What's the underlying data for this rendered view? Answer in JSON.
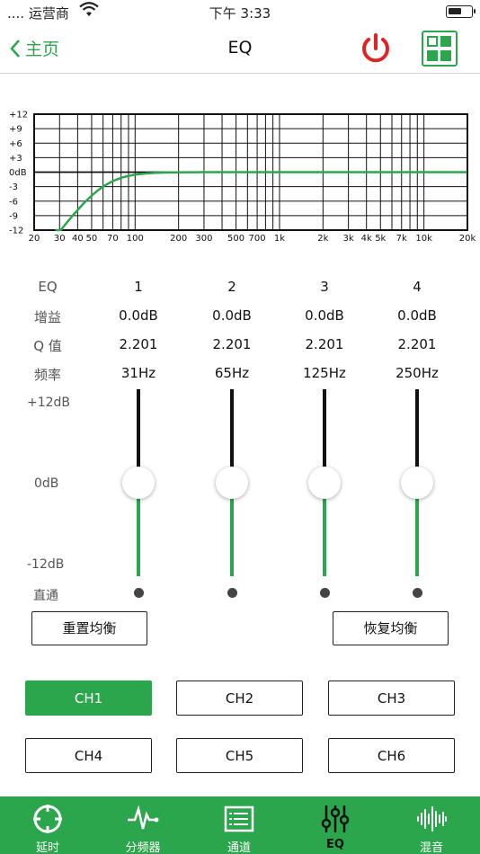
{
  "status_bar": {
    "carrier": "....  运营商",
    "time": "下午 3:33"
  },
  "nav": {
    "back_label": "主页",
    "title": "EQ"
  },
  "graph": {
    "y_ticks": [
      "+12",
      "+9",
      "+6",
      "+3",
      "0dB",
      "-3",
      "-6",
      "-9",
      "-12"
    ],
    "x_ticks": [
      "20",
      "30",
      "40",
      "50",
      "70",
      "100",
      "200",
      "300",
      "500",
      "700",
      "1k",
      "2k",
      "3k",
      "4k",
      "5k",
      "7k",
      "10k",
      "20k"
    ],
    "curve_color": "#2ca64d"
  },
  "params": {
    "header": {
      "label": "EQ",
      "values": [
        "1",
        "2",
        "3",
        "4"
      ]
    },
    "gain": {
      "label": "增益",
      "values": [
        "0.0dB",
        "0.0dB",
        "0.0dB",
        "0.0dB"
      ]
    },
    "q": {
      "label": "Q 值",
      "values": [
        "2.201",
        "2.201",
        "2.201",
        "2.201"
      ]
    },
    "freq": {
      "label": "频率",
      "values": [
        "31Hz",
        "65Hz",
        "125Hz",
        "250Hz"
      ]
    }
  },
  "sliders": {
    "scale_top": "+12dB",
    "scale_mid": "0dB",
    "scale_bottom": "-12dB",
    "bypass_label": "直通",
    "levels_db": [
      0,
      0,
      0,
      0
    ]
  },
  "buttons": {
    "reset": "重置均衡",
    "restore": "恢复均衡"
  },
  "channels": {
    "items": [
      "CH1",
      "CH2",
      "CH3",
      "CH4",
      "CH5",
      "CH6"
    ],
    "selected": "CH1"
  },
  "tabbar": {
    "items": [
      {
        "label": "延时",
        "icon": "crosshair-icon"
      },
      {
        "label": "分频器",
        "icon": "waveform-icon"
      },
      {
        "label": "通道",
        "icon": "list-icon"
      },
      {
        "label": "EQ",
        "icon": "sliders-icon"
      },
      {
        "label": "混音",
        "icon": "audio-wave-icon"
      }
    ],
    "active": "EQ"
  },
  "colors": {
    "accent": "#2ca64d",
    "power": "#e02424"
  }
}
